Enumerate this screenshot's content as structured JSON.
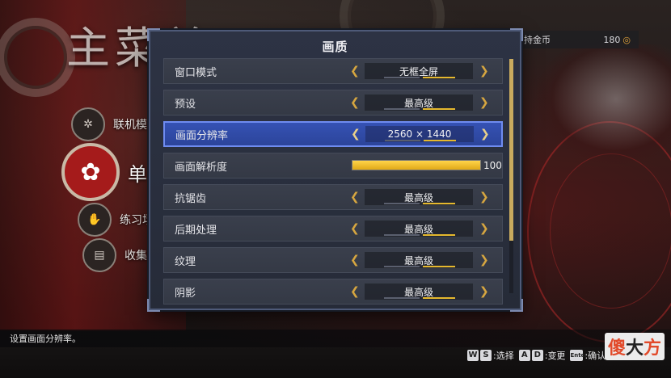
{
  "background": {
    "main_title": "主菜单",
    "side_menu": [
      {
        "label": "联机模式",
        "icon": "network-icon"
      },
      {
        "label": "单",
        "icon": "rose-icon"
      },
      {
        "label": "练习场",
        "icon": "hand-icon"
      },
      {
        "label": "收集",
        "icon": "book-icon"
      }
    ],
    "coins": {
      "label": "持金币",
      "value": "180"
    }
  },
  "dialog": {
    "title": "画质",
    "rows": [
      {
        "label": "窗口模式",
        "value": "无框全屏",
        "type": "select"
      },
      {
        "label": "预设",
        "value": "最高级",
        "type": "select"
      },
      {
        "label": "画面分辨率",
        "value": "2560 × 1440",
        "type": "select",
        "selected": true
      },
      {
        "label": "画面解析度",
        "value": "100",
        "type": "slider",
        "level_percent": 100
      },
      {
        "label": "抗锯齿",
        "value": "最高级",
        "type": "select"
      },
      {
        "label": "后期处理",
        "value": "最高级",
        "type": "select"
      },
      {
        "label": "纹理",
        "value": "最高级",
        "type": "select"
      },
      {
        "label": "阴影",
        "value": "最高级",
        "type": "select"
      }
    ],
    "arrows": {
      "left": "◆",
      "right": "◆"
    },
    "scroll_position_percent": 0
  },
  "hint": "设置画面分辨率。",
  "footer": {
    "keys": [
      {
        "keys": [
          "W",
          "S"
        ],
        "label": "选择"
      },
      {
        "keys": [
          "A",
          "D"
        ],
        "label": "变更"
      },
      {
        "keys": [
          "Enter"
        ],
        "label": "确认"
      }
    ]
  },
  "watermark": [
    "傻",
    "大",
    "方"
  ],
  "colors": {
    "accent_gold": "#e5b82e",
    "selection_blue": "#3552b4",
    "dialog_bg": "#2d3344"
  }
}
